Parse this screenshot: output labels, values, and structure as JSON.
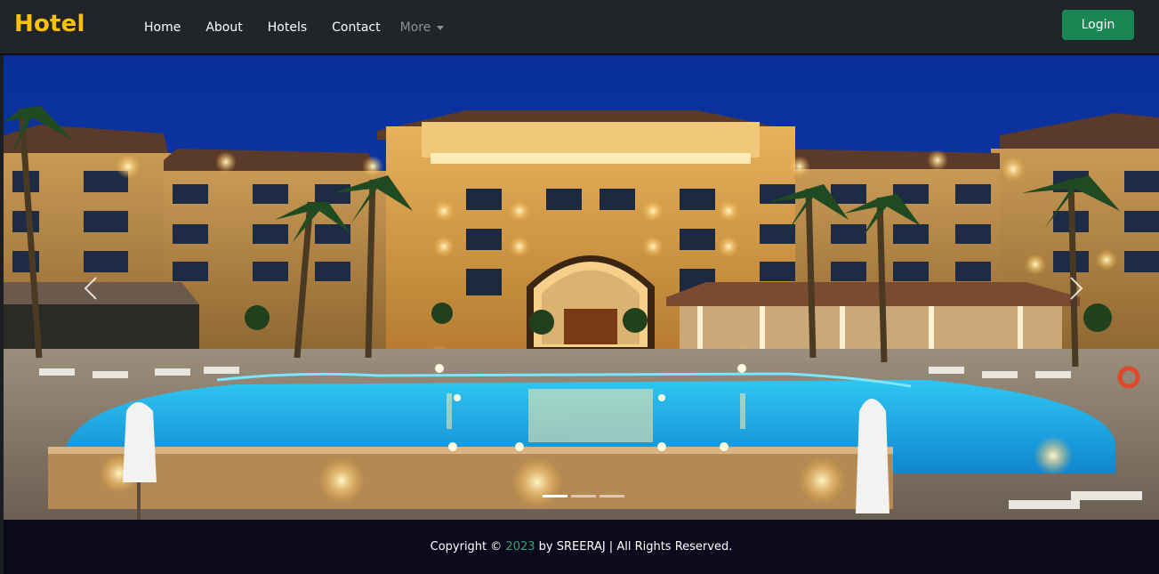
{
  "navbar": {
    "brand": "Hotel",
    "links": [
      "Home",
      "About",
      "Hotels",
      "Contact"
    ],
    "more_label": "More",
    "login_label": "Login"
  },
  "carousel": {
    "slide_count": 3,
    "active_index": 0
  },
  "footer": {
    "prefix": "Copyright ©",
    "year": "2023",
    "suffix": "by SREERAJ | All Rights Reserved."
  },
  "colors": {
    "navbar_bg": "#212529",
    "brand": "#ffc107",
    "login_bg": "#198754",
    "footer_bg": "#0b0a1c",
    "footer_year": "#2fa36b"
  },
  "icons": {
    "prev": "chevron-left-icon",
    "next": "chevron-right-icon",
    "more": "caret-down-icon"
  }
}
